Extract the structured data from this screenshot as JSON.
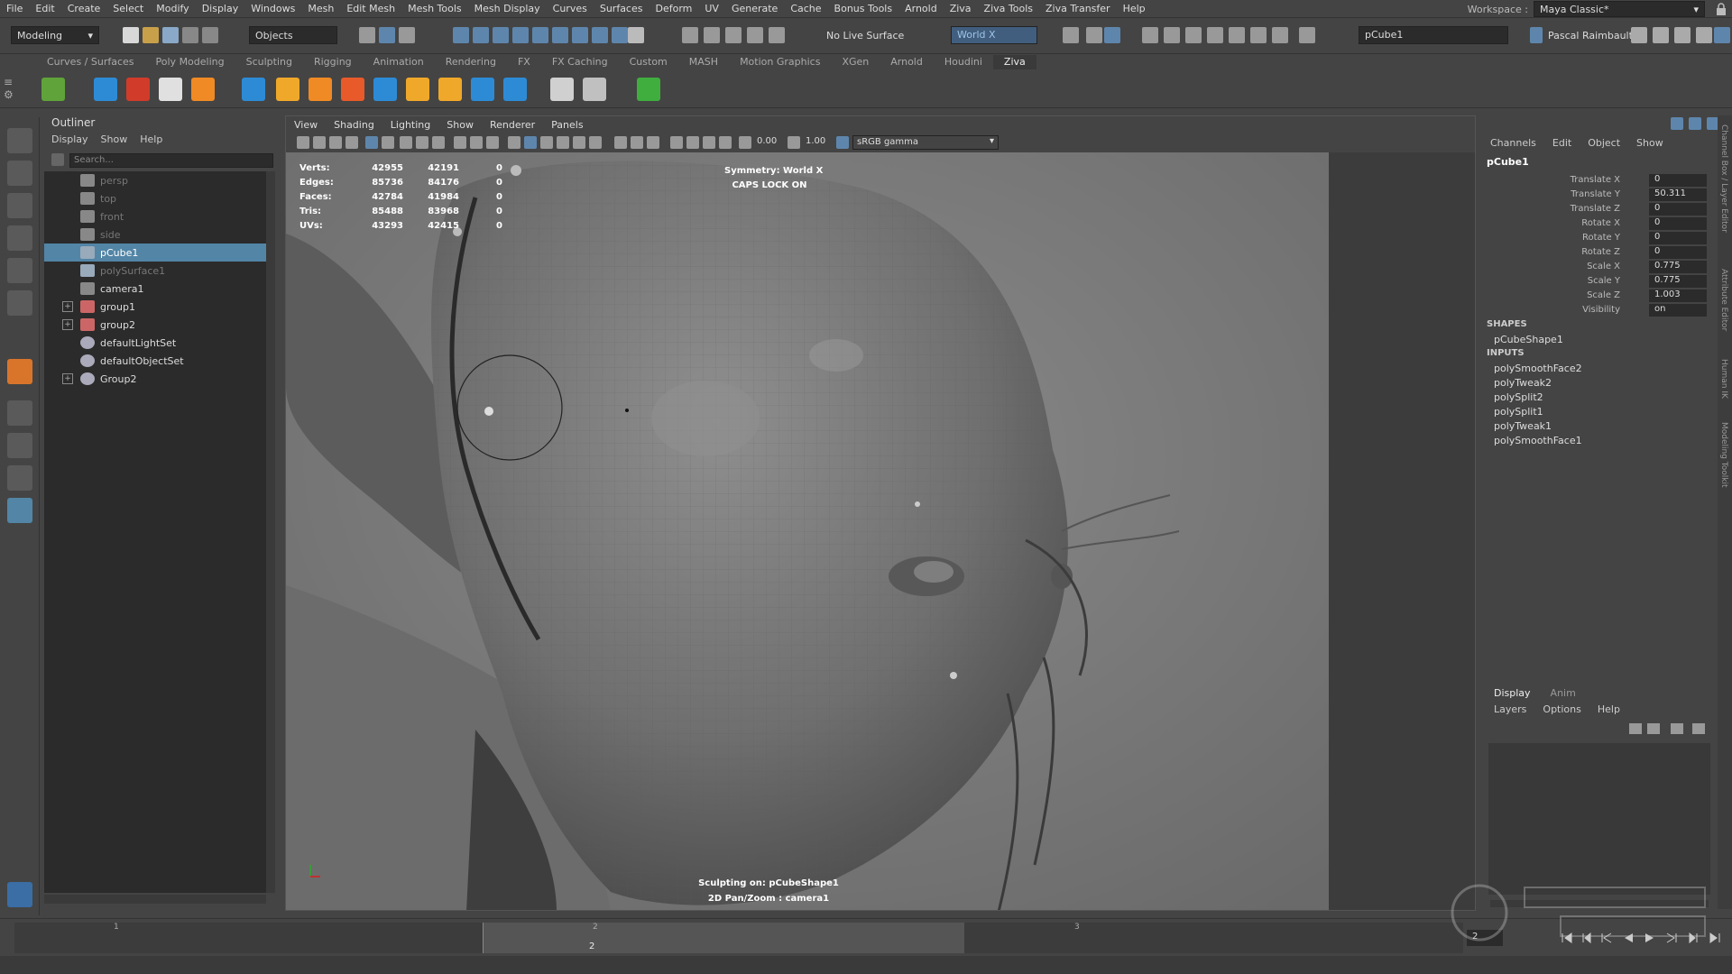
{
  "menubar": {
    "items": [
      "File",
      "Edit",
      "Create",
      "Select",
      "Modify",
      "Display",
      "Windows",
      "Mesh",
      "Edit Mesh",
      "Mesh Tools",
      "Mesh Display",
      "Curves",
      "Surfaces",
      "Deform",
      "UV",
      "Generate",
      "Cache",
      "Bonus Tools",
      "Arnold",
      "Ziva",
      "Ziva Tools",
      "Ziva Transfer",
      "Help"
    ],
    "workspace_label": "Workspace :",
    "workspace_value": "Maya Classic*"
  },
  "statusline": {
    "mode": "Modeling",
    "selection_mode": "Objects",
    "live_surface": "No Live Surface",
    "symmetry": "World X",
    "name_field": "pCube1",
    "user": "Pascal Raimbault"
  },
  "shelf": {
    "tabs": [
      "Curves / Surfaces",
      "Poly Modeling",
      "Sculpting",
      "Rigging",
      "Animation",
      "Rendering",
      "FX",
      "FX Caching",
      "Custom",
      "MASH",
      "Motion Graphics",
      "XGen",
      "Arnold",
      "Houdini",
      "Ziva"
    ],
    "active_tab": "Ziva"
  },
  "outliner": {
    "title": "Outliner",
    "menu": [
      "Display",
      "Show",
      "Help"
    ],
    "search_placeholder": "Search...",
    "items": [
      {
        "label": "persp",
        "dim": true,
        "type": "camera"
      },
      {
        "label": "top",
        "dim": true,
        "type": "camera"
      },
      {
        "label": "front",
        "dim": true,
        "type": "camera"
      },
      {
        "label": "side",
        "dim": true,
        "type": "camera"
      },
      {
        "label": "pCube1",
        "selected": true,
        "type": "mesh"
      },
      {
        "label": "polySurface1",
        "dim": true,
        "type": "mesh"
      },
      {
        "label": "camera1",
        "type": "camera"
      },
      {
        "label": "group1",
        "expand": true,
        "type": "group"
      },
      {
        "label": "group2",
        "expand": true,
        "type": "group"
      },
      {
        "label": "defaultLightSet",
        "type": "set"
      },
      {
        "label": "defaultObjectSet",
        "type": "set"
      },
      {
        "label": "Group2",
        "expand": true,
        "type": "set"
      }
    ]
  },
  "viewport": {
    "menu": [
      "View",
      "Shading",
      "Lighting",
      "Show",
      "Renderer",
      "Panels"
    ],
    "value_a": "0.00",
    "value_b": "1.00",
    "color_space": "sRGB gamma",
    "hud_stats": [
      {
        "label": "Verts:",
        "a": "42955",
        "b": "42191",
        "c": "0"
      },
      {
        "label": "Edges:",
        "a": "85736",
        "b": "84176",
        "c": "0"
      },
      {
        "label": "Faces:",
        "a": "42784",
        "b": "41984",
        "c": "0"
      },
      {
        "label": "Tris:",
        "a": "85488",
        "b": "83968",
        "c": "0"
      },
      {
        "label": "UVs:",
        "a": "43293",
        "b": "42415",
        "c": "0"
      }
    ],
    "symmetry_hud": "Symmetry: World X",
    "caps_lock": "CAPS LOCK ON",
    "sculpting_on": "Sculpting on: pCubeShape1",
    "pan_zoom": "2D Pan/Zoom : camera1"
  },
  "channelbox": {
    "menu": [
      "Channels",
      "Edit",
      "Object",
      "Show"
    ],
    "object": "pCube1",
    "attributes": [
      {
        "label": "Translate X",
        "value": "0"
      },
      {
        "label": "Translate Y",
        "value": "50.311"
      },
      {
        "label": "Translate Z",
        "value": "0"
      },
      {
        "label": "Rotate X",
        "value": "0"
      },
      {
        "label": "Rotate Y",
        "value": "0"
      },
      {
        "label": "Rotate Z",
        "value": "0"
      },
      {
        "label": "Scale X",
        "value": "0.775"
      },
      {
        "label": "Scale Y",
        "value": "0.775"
      },
      {
        "label": "Scale Z",
        "value": "1.003"
      },
      {
        "label": "Visibility",
        "value": "on"
      }
    ],
    "shapes_header": "SHAPES",
    "shapes": [
      "pCubeShape1"
    ],
    "inputs_header": "INPUTS",
    "inputs": [
      "polySmoothFace2",
      "polyTweak2",
      "polySplit2",
      "polySplit1",
      "polyTweak1",
      "polySmoothFace1"
    ],
    "side_tabs": [
      "Channel Box / Layer Editor",
      "Attribute Editor",
      "Human IK",
      "Modeling Toolkit"
    ]
  },
  "layereditor": {
    "tabs": [
      "Display",
      "Anim"
    ],
    "menu": [
      "Layers",
      "Options",
      "Help"
    ]
  },
  "timeslider": {
    "ticks": [
      "1",
      "2",
      "3"
    ],
    "current_frame": "2",
    "frame_field": "2"
  },
  "colors": {
    "accent": "#5285a6",
    "panel": "#444444",
    "field": "#2b2b2b",
    "viewport_bg": "#787878"
  }
}
